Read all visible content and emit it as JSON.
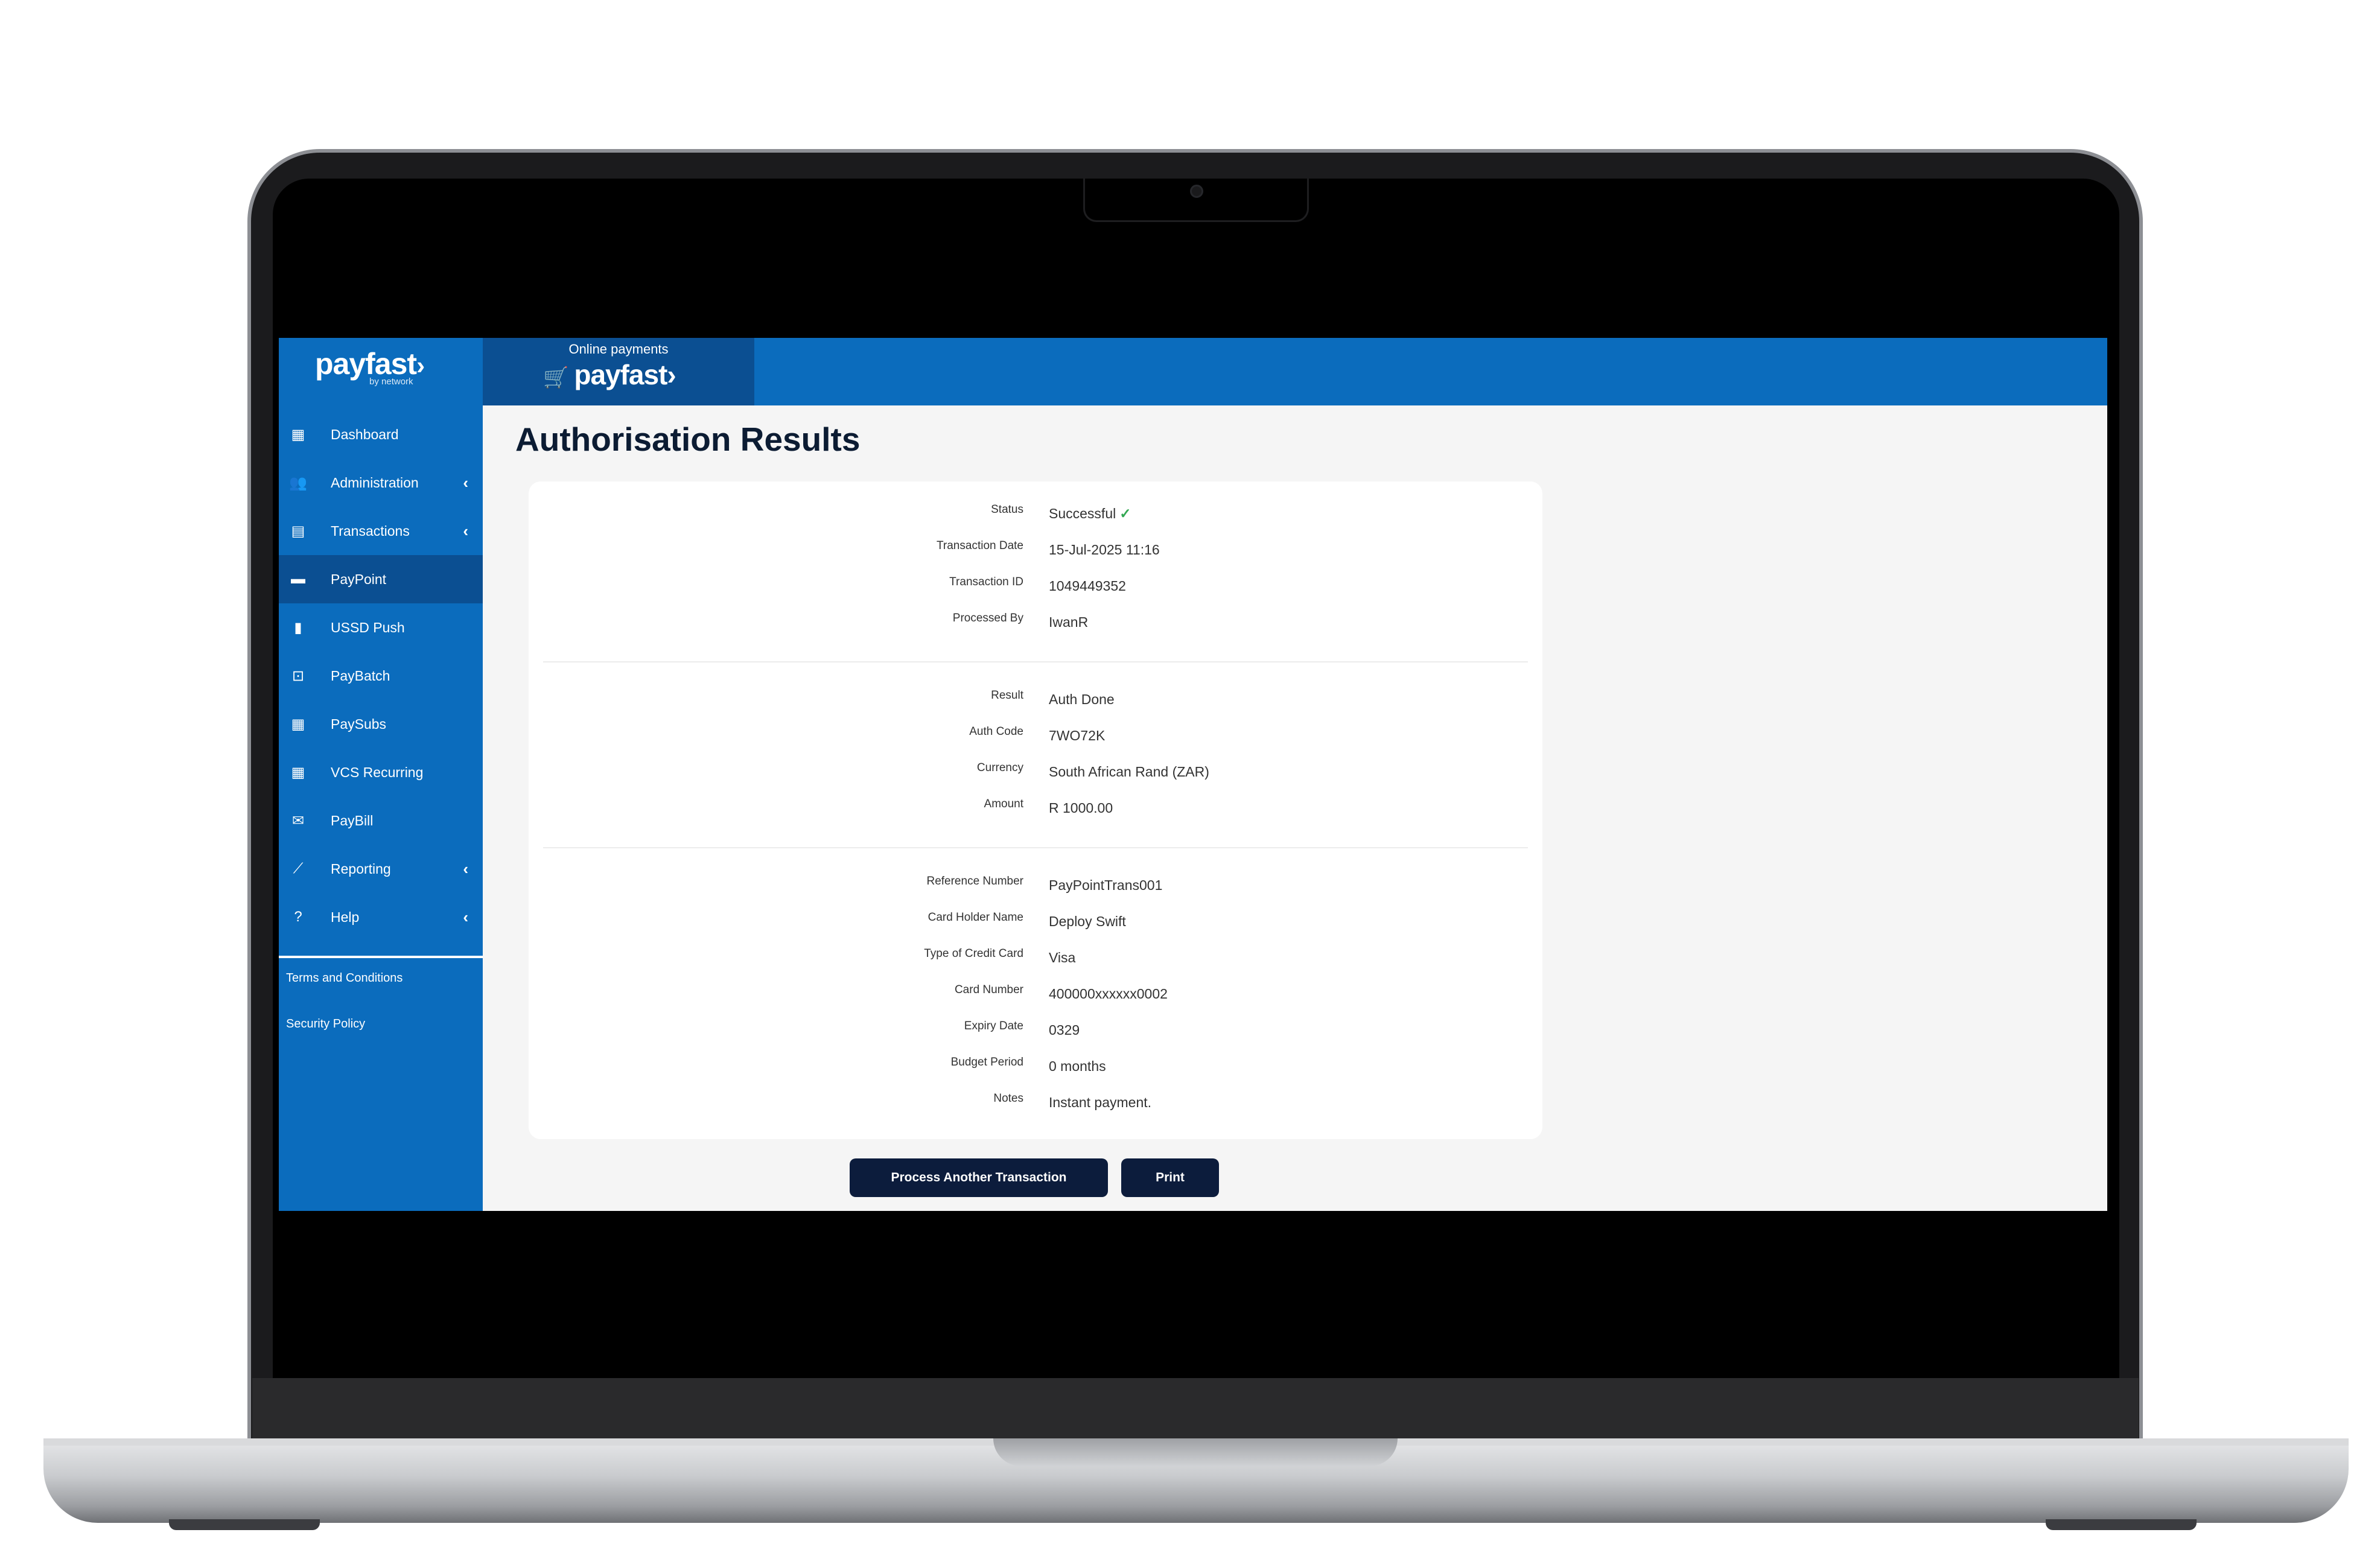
{
  "sidebar": {
    "brand": {
      "name": "payfast",
      "chevron": "›",
      "sub": "by network"
    },
    "items": [
      {
        "label": "Dashboard",
        "icon": "grid-icon",
        "glyph": "▦",
        "caret": ""
      },
      {
        "label": "Administration",
        "icon": "users-icon",
        "glyph": "👥",
        "caret": "‹"
      },
      {
        "label": "Transactions",
        "icon": "calculator-icon",
        "glyph": "▤",
        "caret": "‹"
      },
      {
        "label": "PayPoint",
        "icon": "card-icon",
        "glyph": "▬",
        "caret": "",
        "active": true
      },
      {
        "label": "USSD Push",
        "icon": "phone-icon",
        "glyph": "▮",
        "caret": ""
      },
      {
        "label": "PayBatch",
        "icon": "batch-icon",
        "glyph": "⊡",
        "caret": ""
      },
      {
        "label": "PaySubs",
        "icon": "calendar-icon",
        "glyph": "▦",
        "caret": ""
      },
      {
        "label": "VCS Recurring",
        "icon": "calendar-icon",
        "glyph": "▦",
        "caret": ""
      },
      {
        "label": "PayBill",
        "icon": "envelope-icon",
        "glyph": "✉",
        "caret": ""
      },
      {
        "label": "Reporting",
        "icon": "chart-icon",
        "glyph": "⟋",
        "caret": "‹"
      },
      {
        "label": "Help",
        "icon": "help-icon",
        "glyph": "?",
        "caret": "‹"
      }
    ],
    "links": {
      "terms": "Terms and Conditions",
      "security": "Security Policy"
    }
  },
  "topbar": {
    "tab_label": "Online payments",
    "tab_logo": "payfast",
    "tab_logo_chevron": "›",
    "cart_icon": "🛒"
  },
  "page": {
    "title": "Authorisation Results"
  },
  "results": {
    "status": {
      "label": "Status",
      "value": "Successful",
      "check": "✓"
    },
    "transaction_date": {
      "label": "Transaction Date",
      "value": "15-Jul-2025 11:16"
    },
    "transaction_id": {
      "label": "Transaction ID",
      "value": "1049449352"
    },
    "processed_by": {
      "label": "Processed By",
      "value": "IwanR"
    },
    "result": {
      "label": "Result",
      "value": "Auth Done"
    },
    "auth_code": {
      "label": "Auth Code",
      "value": "7WO72K"
    },
    "currency": {
      "label": "Currency",
      "value": "South African Rand (ZAR)"
    },
    "amount": {
      "label": "Amount",
      "value": "R 1000.00"
    },
    "reference_number": {
      "label": "Reference Number",
      "value": "PayPointTrans001"
    },
    "card_holder": {
      "label": "Card Holder Name",
      "value": "Deploy Swift"
    },
    "card_type": {
      "label": "Type of Credit Card",
      "value": "Visa"
    },
    "card_number": {
      "label": "Card Number",
      "value": "400000xxxxxx0002"
    },
    "expiry": {
      "label": "Expiry Date",
      "value": "0329"
    },
    "budget": {
      "label": "Budget Period",
      "value": "0 months"
    },
    "notes": {
      "label": "Notes",
      "value": "Instant payment."
    }
  },
  "actions": {
    "process_another": "Process Another Transaction",
    "print": "Print"
  },
  "colors": {
    "brand_blue": "#0b6cbd",
    "active_blue": "#0b4f92",
    "button_navy": "#0c1c3c",
    "success_green": "#34a853"
  }
}
